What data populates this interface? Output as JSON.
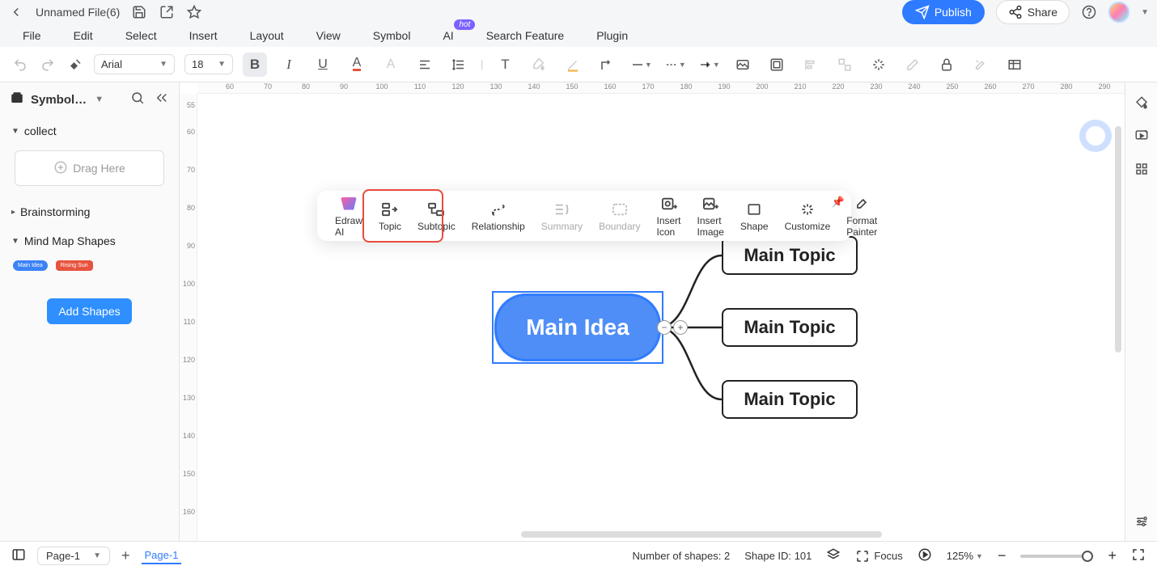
{
  "title": "Unnamed File(6)",
  "menu": [
    "File",
    "Edit",
    "Select",
    "Insert",
    "Layout",
    "View",
    "Symbol",
    "AI",
    "Search Feature",
    "Plugin"
  ],
  "hot_badge": "hot",
  "publish_label": "Publish",
  "share_label": "Share",
  "font": {
    "family": "Arial",
    "size": "18"
  },
  "sidebar": {
    "title": "Symbol…",
    "drag_here": "Drag Here",
    "sections": {
      "collect": "collect",
      "brainstorming": "Brainstorming",
      "mind_map_shapes": "Mind Map Shapes"
    },
    "mini_shapes": [
      "Main Idea",
      "Rising Sun"
    ],
    "add_shapes": "Add Shapes"
  },
  "context_toolbar": {
    "items": [
      {
        "key": "edraw_ai",
        "label": "Edraw AI"
      },
      {
        "key": "topic",
        "label": "Topic"
      },
      {
        "key": "subtopic",
        "label": "Subtopic"
      },
      {
        "key": "relationship",
        "label": "Relationship"
      },
      {
        "key": "summary",
        "label": "Summary",
        "disabled": true
      },
      {
        "key": "boundary",
        "label": "Boundary",
        "disabled": true
      },
      {
        "key": "insert_icon",
        "label": "Insert Icon"
      },
      {
        "key": "insert_image",
        "label": "Insert Image"
      },
      {
        "key": "shape",
        "label": "Shape"
      },
      {
        "key": "customize",
        "label": "Customize"
      },
      {
        "key": "format_painter",
        "label": "Format Painter"
      }
    ]
  },
  "canvas": {
    "main_idea": "Main Idea",
    "topics": [
      "Main Topic",
      "Main Topic",
      "Main Topic"
    ]
  },
  "hruler_ticks": [
    "60",
    "70",
    "80",
    "90",
    "100",
    "110",
    "120",
    "130",
    "140",
    "150",
    "160",
    "170",
    "180",
    "190",
    "200",
    "210",
    "220",
    "230",
    "240",
    "250",
    "260",
    "270",
    "280",
    "290"
  ],
  "vruler_ticks": [
    "55",
    "60",
    "70",
    "80",
    "90",
    "100",
    "110",
    "120",
    "130",
    "140",
    "150",
    "160"
  ],
  "status": {
    "page_name": "Page-1",
    "active_tab": "Page-1",
    "num_shapes_label": "Number of shapes:",
    "num_shapes_value": "2",
    "shape_id_label": "Shape ID:",
    "shape_id_value": "101",
    "focus": "Focus",
    "zoom": "125%"
  }
}
